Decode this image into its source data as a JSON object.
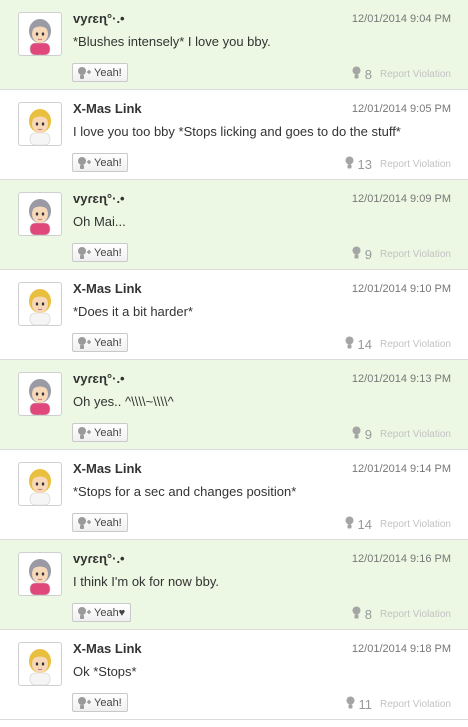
{
  "posts": [
    {
      "author": "vyɾɛɳ°·.•",
      "avatar": "gray-hair-avatar",
      "time": "12/01/2014 9:04 PM",
      "text": "*Blushes intensely* I love you bby.",
      "yeah": "Yeah!",
      "count": "8",
      "report": "Report Violation",
      "bg": "green"
    },
    {
      "author": "X-Mas Link",
      "avatar": "blonde-avatar",
      "time": "12/01/2014 9:05 PM",
      "text": "I love you too bby *Stops licking and goes to do the stuff*",
      "yeah": "Yeah!",
      "count": "13",
      "report": "Report Violation",
      "bg": "white"
    },
    {
      "author": "vyɾɛɳ°·.•",
      "avatar": "gray-hair-avatar",
      "time": "12/01/2014 9:09 PM",
      "text": "Oh Mai...",
      "yeah": "Yeah!",
      "count": "9",
      "report": "Report Violation",
      "bg": "green"
    },
    {
      "author": "X-Mas Link",
      "avatar": "blonde-avatar",
      "time": "12/01/2014 9:10 PM",
      "text": "*Does it a bit harder*",
      "yeah": "Yeah!",
      "count": "14",
      "report": "Report Violation",
      "bg": "white"
    },
    {
      "author": "vyɾɛɳ°·.•",
      "avatar": "gray-hair-avatar",
      "time": "12/01/2014 9:13 PM",
      "text": "Oh yes.. ^\\\\\\\\~\\\\\\\\^",
      "yeah": "Yeah!",
      "count": "9",
      "report": "Report Violation",
      "bg": "green"
    },
    {
      "author": "X-Mas Link",
      "avatar": "blonde-avatar",
      "time": "12/01/2014 9:14 PM",
      "text": "*Stops for a sec and changes position*",
      "yeah": "Yeah!",
      "count": "14",
      "report": "Report Violation",
      "bg": "white"
    },
    {
      "author": "vyɾɛɳ°·.•",
      "avatar": "gray-hair-avatar",
      "time": "12/01/2014 9:16 PM",
      "text": "I think I'm ok for now bby.",
      "yeah": "Yeah♥",
      "count": "8",
      "report": "Report Violation",
      "bg": "green"
    },
    {
      "author": "X-Mas Link",
      "avatar": "blonde-avatar",
      "time": "12/01/2014 9:18 PM",
      "text": "Ok *Stops*",
      "yeah": "Yeah!",
      "count": "11",
      "report": "Report Violation",
      "bg": "white"
    }
  ],
  "colors": {
    "green_row": "#ecf8e3",
    "white_row": "#ffffff",
    "gray_hair": "#9a9aa4",
    "blonde_hair": "#e9bf3f",
    "shirt_pink": "#e0477a",
    "shirt_white": "#f5f5f5"
  }
}
